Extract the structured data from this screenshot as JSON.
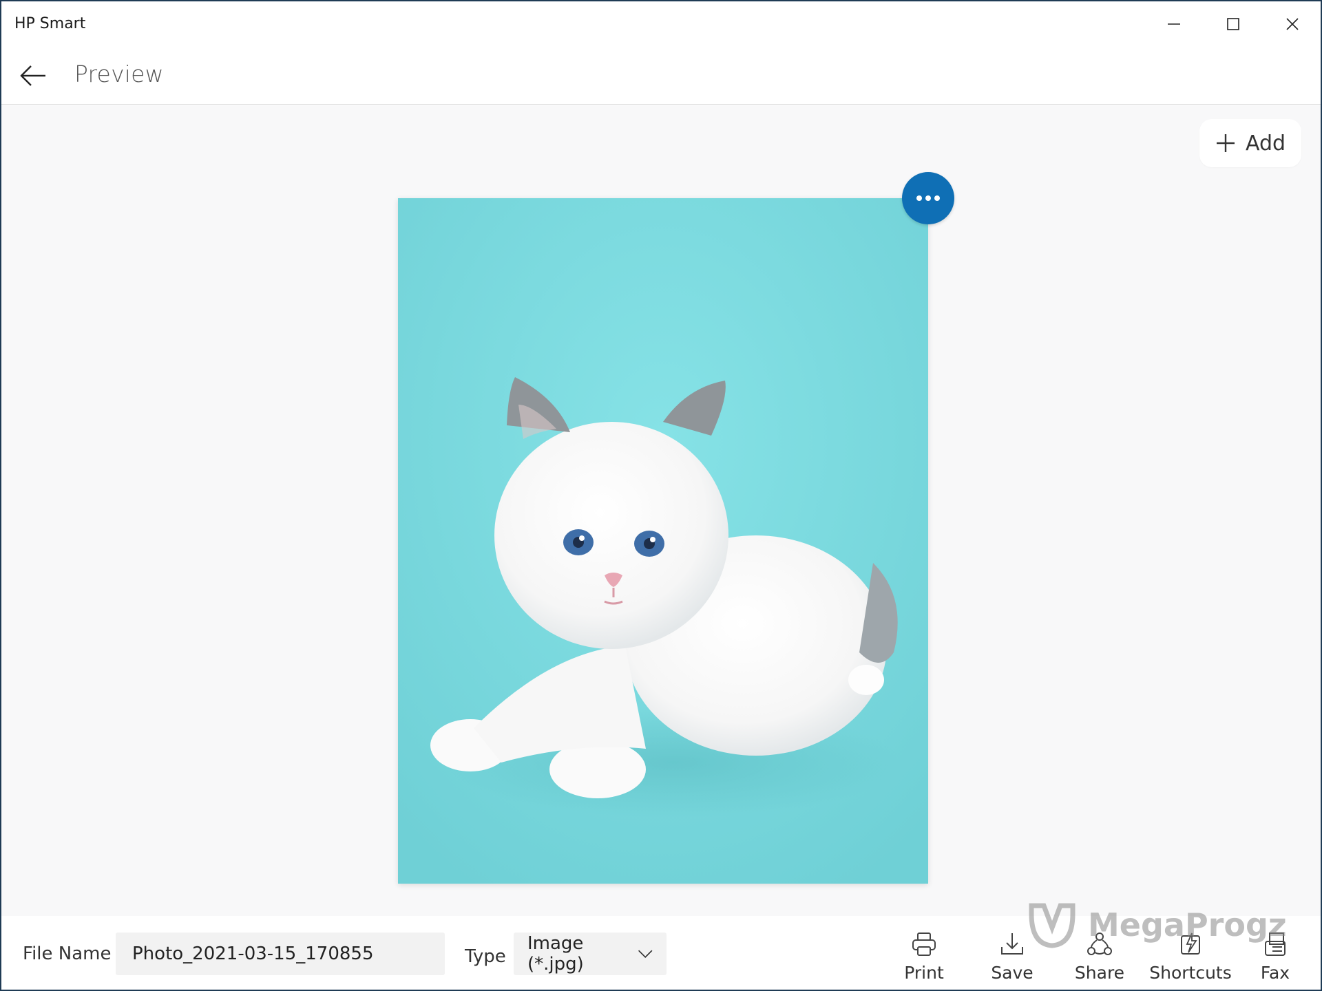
{
  "app": {
    "title": "HP Smart"
  },
  "window_controls": {
    "minimize_icon": "minimize-icon",
    "maximize_icon": "maximize-icon",
    "close_icon": "close-icon"
  },
  "header": {
    "back_icon": "arrow-left-icon",
    "title": "Preview"
  },
  "content": {
    "add_button": {
      "icon": "plus-icon",
      "label": "Add"
    },
    "more_button": {
      "icon": "ellipsis-icon",
      "color": "#0f6fb5"
    },
    "photo": {
      "background_color": "#7dd9de"
    }
  },
  "bottom_bar": {
    "file_name_label": "File Name",
    "file_name_value": "Photo_2021-03-15_170855",
    "type_label": "Type",
    "type_value": "Image (*.jpg)",
    "actions": [
      {
        "label": "Print",
        "icon": "printer-icon"
      },
      {
        "label": "Save",
        "icon": "download-icon"
      },
      {
        "label": "Share",
        "icon": "share-icon"
      },
      {
        "label": "Shortcuts",
        "icon": "shortcuts-icon"
      },
      {
        "label": "Fax",
        "icon": "fax-icon"
      }
    ]
  },
  "watermark": {
    "text": "MegaProgz"
  }
}
